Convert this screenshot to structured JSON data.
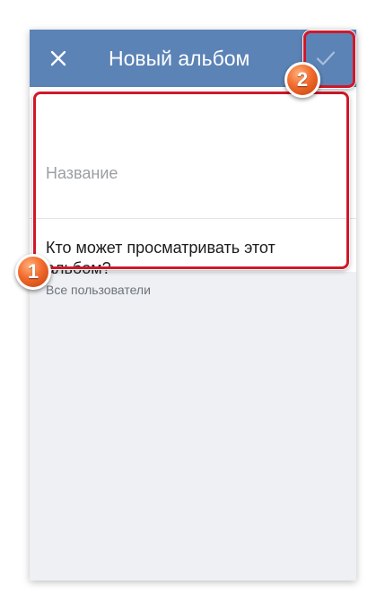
{
  "header": {
    "title": "Новый альбом",
    "close_icon": "close-icon",
    "save_icon": "check-icon"
  },
  "form": {
    "name_placeholder": "Название",
    "name_value": "",
    "privacy_label": "Кто может просматривать этот альбом?",
    "privacy_value": "Все пользователи"
  },
  "annotations": {
    "badge_1": "1",
    "badge_2": "2"
  },
  "colors": {
    "toolbar": "#5b83b6",
    "highlight": "#d0182a",
    "badge": "#f26a2d",
    "background": "#eef0f3"
  }
}
